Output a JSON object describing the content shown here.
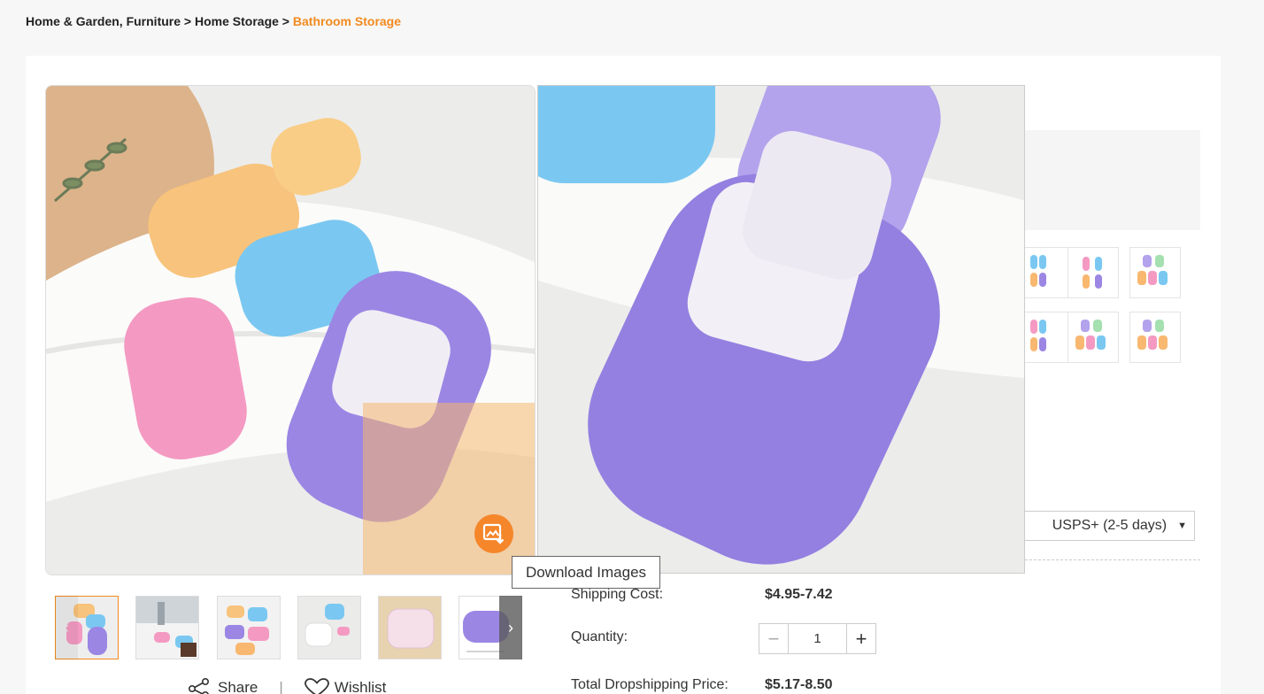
{
  "breadcrumb": {
    "part1": "Home & Garden, Furniture",
    "sep1": " > ",
    "part2": "Home Storage",
    "sep2": " > ",
    "current": "Bathroom Storage"
  },
  "tooltip": {
    "text": "Download Images"
  },
  "shipping": {
    "method": "USPS+ (2-5 days)",
    "cost_label": "Shipping Cost:",
    "cost_value": "$4.95-7.42"
  },
  "quantity": {
    "label": "Quantity:",
    "value": "1",
    "minus": "−",
    "plus": "+"
  },
  "total": {
    "label": "Total Dropshipping Price:",
    "value": "$5.17-8.50"
  },
  "actions": {
    "share": "Share",
    "separator": "|",
    "wishlist": "Wishlist"
  },
  "icons": {
    "download": "download-image-icon",
    "share": "share-icon",
    "wishlist": "heart-icon",
    "prev": "chevron-left-icon",
    "next": "chevron-right-icon",
    "dropdown": "caret-down-icon"
  },
  "colors": {
    "accent": "#f28a1e",
    "download_button": "#f5862a"
  }
}
